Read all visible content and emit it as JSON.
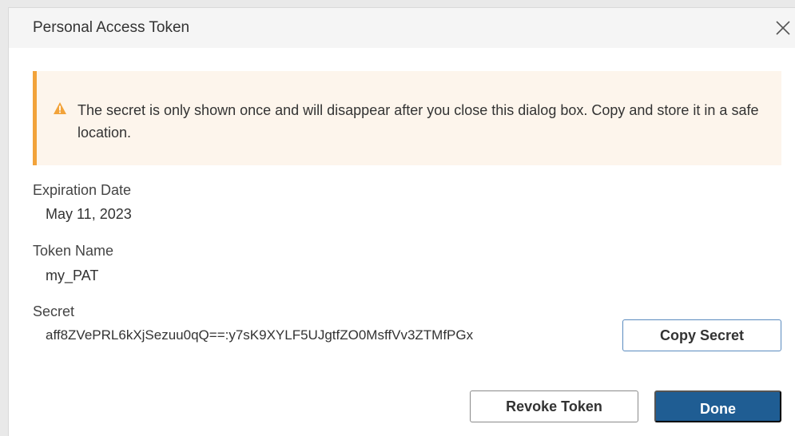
{
  "dialog": {
    "title": "Personal Access Token",
    "close_icon": "close-icon"
  },
  "alert": {
    "icon": "warning-icon",
    "accent_color": "#f2a33a",
    "message": "The secret is only shown once and will disappear after you close this dialog box. Copy and store it in a safe location."
  },
  "fields": {
    "expiration_label": "Expiration Date",
    "expiration_value": "May 11, 2023",
    "token_name_label": "Token Name",
    "token_name_value": "my_PAT",
    "secret_label": "Secret",
    "secret_value": "aff8ZVePRL6kXjSezuu0qQ==:y7sK9XYLF5UJgtfZO0MsffVv3ZTMfPGx"
  },
  "buttons": {
    "copy_secret": "Copy Secret",
    "revoke_token": "Revoke Token",
    "done": "Done",
    "primary_color": "#1f5d93"
  }
}
